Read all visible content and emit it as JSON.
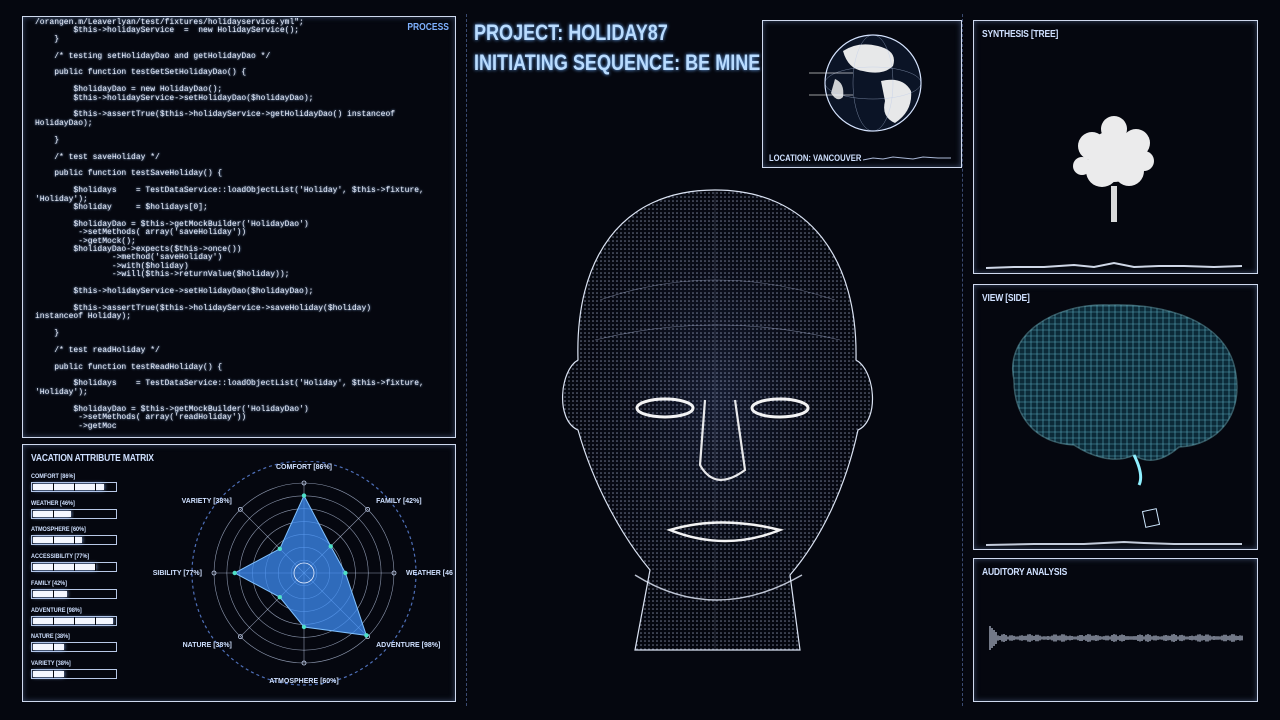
{
  "code": {
    "process_label": "PROCESS",
    "lines": [
      "/orangen.m/Leaverlyan/test/fixtures/holidayservice.yml\";",
      "        $this->holidayService  =  new HolidayService();",
      "    }",
      "",
      "    /* testing setHolidayDao and getHolidayDao */",
      "",
      "    public function testGetSetHolidayDao() {",
      "",
      "        $holidayDao = new HolidayDao();",
      "        $this->holidayService->setHolidayDao($holidayDao);",
      "",
      "        $this->assertTrue($this->holidayService->getHolidayDao() instanceof",
      "HolidayDao);",
      "",
      "    }",
      "",
      "    /* test saveHoliday */",
      "",
      "    public function testSaveHoliday() {",
      "",
      "        $holidays    = TestDataService::loadObjectList('Holiday', $this->fixture,",
      "'Holiday');",
      "        $holiday     = $holidays[0];",
      "",
      "        $holidayDao = $this->getMockBuilder('HolidayDao')",
      "         ->setMethods( array('saveHoliday'))",
      "         ->getMock();",
      "        $holidayDao->expects($this->once())",
      "                ->method('saveHoliday')",
      "                ->with($holiday)",
      "                ->will($this->returnValue($holiday));",
      "",
      "        $this->holidayService->setHolidayDao($holidayDao);",
      "",
      "        $this->assertTrue($this->holidayService->saveHoliday($holiday)",
      "instanceof Holiday);",
      "",
      "    }",
      "",
      "    /* test readHoliday */",
      "",
      "    public function testReadHoliday() {",
      "",
      "        $holidays    = TestDataService::loadObjectList('Holiday', $this->fixture,",
      "'Holiday');",
      "",
      "        $holidayDao = $this->getMockBuilder('HolidayDao')",
      "         ->setMethods( array('readHoliday'))",
      "         ->getMoc"
    ]
  },
  "matrix": {
    "title": "VACATION ATTRIBUTE MATRIX",
    "attributes": [
      {
        "label": "COMFORT [86%]",
        "value": 86
      },
      {
        "label": "WEATHER [46%]",
        "value": 46
      },
      {
        "label": "ATMOSPHERE [60%]",
        "value": 60
      },
      {
        "label": "ACCESSIBILITY [77%]",
        "value": 77
      },
      {
        "label": "FAMILY [42%]",
        "value": 42
      },
      {
        "label": "ADVENTURE [98%]",
        "value": 98
      },
      {
        "label": "NATURE [38%]",
        "value": 38
      },
      {
        "label": "VARIETY [38%]",
        "value": 38
      }
    ]
  },
  "chart_data": {
    "type": "radar",
    "title": "VACATION ATTRIBUTE MATRIX",
    "axes": [
      {
        "label": "COMFORT [86%]",
        "value": 86
      },
      {
        "label": "FAMILY [42%]",
        "value": 42
      },
      {
        "label": "WEATHER [46%]",
        "value": 46
      },
      {
        "label": "ADVENTURE [98%]",
        "value": 98
      },
      {
        "label": "ATMOSPHERE [60%]",
        "value": 60
      },
      {
        "label": "NATURE [38%]",
        "value": 38
      },
      {
        "label": "ACCESSIBILITY [77%]",
        "value": 77
      },
      {
        "label": "VARIETY [38%]",
        "value": 38
      }
    ],
    "range": [
      0,
      100
    ],
    "grid": true
  },
  "header": {
    "project": "PROJECT: HOLIDAY87",
    "sequence": "INITIATING SEQUENCE: BE MINE"
  },
  "globe": {
    "location": "LOCATION: VANCOUVER"
  },
  "synthesis": {
    "title": "SYNTHESIS [TREE]"
  },
  "view": {
    "title": "VIEW [SIDE]"
  },
  "auditory": {
    "title": "AUDITORY ANALYSIS"
  },
  "colors": {
    "accent": "#7fb2ff",
    "radar_fill": "#3d8ef5",
    "node": "#4fe0c8",
    "brain": "#6fe6ff"
  }
}
